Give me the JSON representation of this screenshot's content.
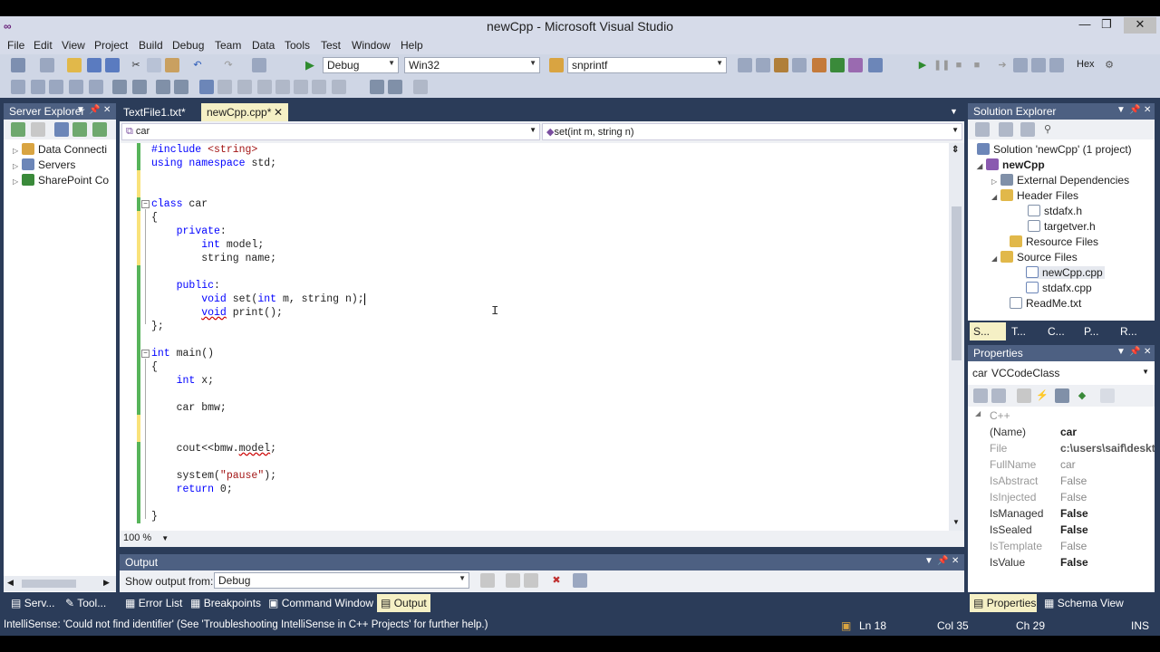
{
  "window": {
    "title": "newCpp - Microsoft Visual Studio",
    "minimize": "—",
    "restore": "❐",
    "close": "✕"
  },
  "menu": [
    "File",
    "Edit",
    "View",
    "Project",
    "Build",
    "Debug",
    "Team",
    "Data",
    "Tools",
    "Test",
    "Window",
    "Help"
  ],
  "toolbar": {
    "config": "Debug",
    "platform": "Win32",
    "find": "snprintf",
    "hex": "Hex"
  },
  "server_explorer": {
    "title": "Server Explorer",
    "items": [
      "Data Connecti",
      "Servers",
      "SharePoint Co"
    ]
  },
  "tabs": [
    {
      "label": "TextFile1.txt*"
    },
    {
      "label": "newCpp.cpp*"
    }
  ],
  "editor": {
    "nav_left": "car",
    "nav_right": "set(int m, string n)",
    "zoom": "100 %"
  },
  "output": {
    "title": "Output",
    "show_from_label": "Show output from:",
    "source": "Debug"
  },
  "bottom_tabs": [
    "Serv...",
    "Tool...",
    "Error List",
    "Breakpoints",
    "Command Window",
    "Output"
  ],
  "status": {
    "message": "IntelliSense: 'Could not find identifier' (See 'Troubleshooting IntelliSense in C++ Projects' for further help.)",
    "line": "Ln 18",
    "col": "Col 35",
    "ch": "Ch 29",
    "mode": "INS"
  },
  "solution_explorer": {
    "title": "Solution Explorer",
    "items": [
      "Solution 'newCpp' (1 project)",
      "newCpp",
      "External Dependencies",
      "Header Files",
      "stdafx.h",
      "targetver.h",
      "Resource Files",
      "Source Files",
      "newCpp.cpp",
      "stdafx.cpp",
      "ReadMe.txt"
    ],
    "tabs": [
      "S...",
      "T...",
      "C...",
      "P...",
      "R..."
    ]
  },
  "properties": {
    "title": "Properties",
    "object": "car",
    "object_type": "VCCodeClass",
    "category": "C++",
    "rows": [
      {
        "name": "(Name)",
        "value": "car"
      },
      {
        "name": "File",
        "value": "c:\\users\\saif\\deskto"
      },
      {
        "name": "FullName",
        "value": "car"
      },
      {
        "name": "IsAbstract",
        "value": "False"
      },
      {
        "name": "IsInjected",
        "value": "False"
      },
      {
        "name": "IsManaged",
        "value": "False"
      },
      {
        "name": "IsSealed",
        "value": "False"
      },
      {
        "name": "IsTemplate",
        "value": "False"
      },
      {
        "name": "IsValue",
        "value": "False"
      }
    ],
    "tabs": [
      "Properties",
      "Schema View"
    ]
  },
  "colors": {
    "accent": "#2b3c59",
    "keyword": "#0000ff",
    "string": "#a31515",
    "changed_bar": "#f9e27a",
    "saved_bar": "#57b45a",
    "active_tab": "#f5f0c5"
  }
}
